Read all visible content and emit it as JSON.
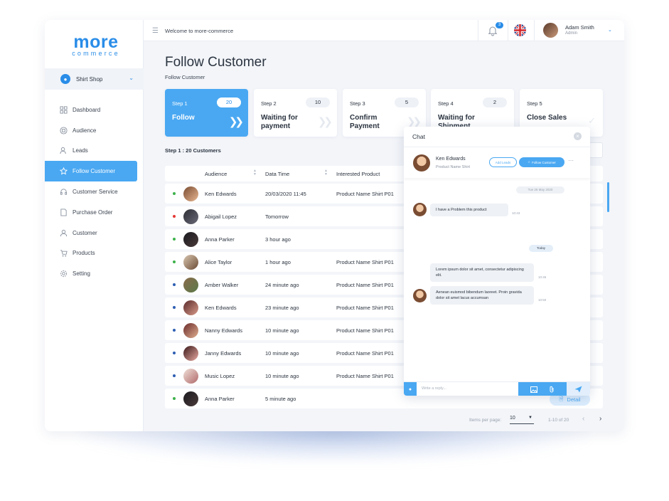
{
  "brand": {
    "name": "more",
    "sub": "commerce",
    "color": "#2a8de8"
  },
  "shop": {
    "label": "Shirt Shop"
  },
  "nav": [
    {
      "label": "Dashboard",
      "icon": "dashboard-icon",
      "active": false
    },
    {
      "label": "Audience",
      "icon": "audience-icon",
      "active": false
    },
    {
      "label": "Leads",
      "icon": "leads-icon",
      "active": false
    },
    {
      "label": "Follow Customer",
      "icon": "star-icon",
      "active": true
    },
    {
      "label": "Customer Service",
      "icon": "headset-icon",
      "active": false
    },
    {
      "label": "Purchase Order",
      "icon": "document-icon",
      "active": false
    },
    {
      "label": "Customer",
      "icon": "user-icon",
      "active": false
    },
    {
      "label": "Products",
      "icon": "cart-icon",
      "active": false
    },
    {
      "label": "Setting",
      "icon": "gear-icon",
      "active": false
    }
  ],
  "header": {
    "welcome": "Welcome to more-commerce",
    "notifications": "3",
    "user_name": "Adam Smith",
    "user_role": "Admin"
  },
  "page": {
    "title": "Follow Customer",
    "subtitle": "Follow Customer"
  },
  "steps": [
    {
      "no": "Step 1",
      "count": "20",
      "name": "Follow"
    },
    {
      "no": "Step 2",
      "count": "10",
      "name": "Waiting for payment"
    },
    {
      "no": "Step 3",
      "count": "5",
      "name": "Confirm Payment"
    },
    {
      "no": "Step 4",
      "count": "2",
      "name": "Waiting for Shipment"
    },
    {
      "no": "Step 5",
      "count": "",
      "name": "Close Sales"
    }
  ],
  "count_label": "Step 1 : 20 Customers",
  "table": {
    "headers": [
      "Audience",
      "Data Time",
      "Interested Product"
    ],
    "rows": [
      {
        "name": "Ken Edwards",
        "time": "20/03/2020 11:45",
        "product": "Product Name Shirt P01",
        "status": "#3db24b"
      },
      {
        "name": "Abigail Lopez",
        "time": "Tomorrow",
        "product": "",
        "status": "#e53935"
      },
      {
        "name": "Anna Parker",
        "time": "3 hour ago",
        "product": "",
        "status": "#3db24b"
      },
      {
        "name": "Alice Taylor",
        "time": "1 hour ago",
        "product": "Product Name Shirt P01",
        "status": "#3db24b"
      },
      {
        "name": "Amber Walker",
        "time": "24 minute ago",
        "product": "Product Name Shirt P01",
        "status": "#2f5fb3"
      },
      {
        "name": "Ken Edwards",
        "time": "23 minute ago",
        "product": "Product Name Shirt P01",
        "status": "#2f5fb3"
      },
      {
        "name": "Nanny Edwards",
        "time": "10 minute ago",
        "product": "Product Name Shirt P01",
        "status": "#2f5fb3"
      },
      {
        "name": "Janny Edwards",
        "time": "10 minute ago",
        "product": "Product Name Shirt P01",
        "status": "#2f5fb3"
      },
      {
        "name": "Music Lopez",
        "time": "10 minute ago",
        "product": "Product Name Shirt P01",
        "status": "#2f5fb3"
      },
      {
        "name": "Anna Parker",
        "time": "5 minute ago",
        "product": "",
        "status": "#3db24b"
      }
    ],
    "detail_label": "Detail"
  },
  "pagination": {
    "items_label": "Items per page:",
    "per_page": "10",
    "range": "1-10 of 20"
  },
  "chat": {
    "title": "Chat",
    "contact_name": "Ken Edwards",
    "contact_product": "Product Name Shirt",
    "add_leads": "Add Leads",
    "follow_customer": "Follow Customer",
    "date_chip": "Tue 26 May 2020",
    "today_chip": "Today",
    "messages": [
      {
        "text": "I have a Problem this product",
        "time": "10:43"
      },
      {
        "text": "Lorem ipsum dolor sit amet, consectetur adipiscing elit.",
        "time": "10:45"
      },
      {
        "text": "Aenean euismod bibendum laoreet. Proin gravida dolor sit amet lacus accumsan",
        "time": "10:50"
      }
    ],
    "input_placeholder": "Write a reply..."
  }
}
